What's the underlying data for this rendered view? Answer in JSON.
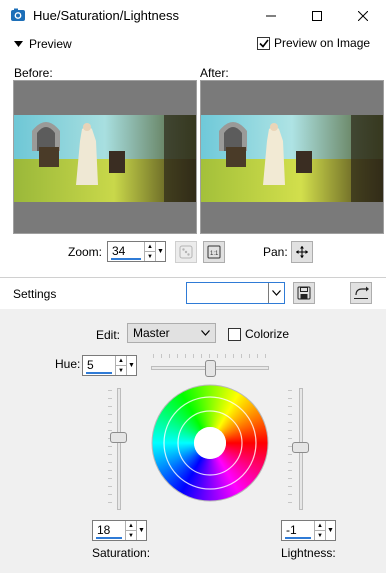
{
  "window": {
    "title": "Hue/Saturation/Lightness",
    "minimize_glyph": "—",
    "maximize_glyph": "☐",
    "close_glyph": "✕"
  },
  "preview": {
    "section_label": "Preview",
    "preview_on_image_label": "Preview on Image",
    "preview_on_image_checked": true,
    "before_label": "Before:",
    "after_label": "After:"
  },
  "zoom": {
    "label": "Zoom:",
    "value": "34",
    "pan_label": "Pan:"
  },
  "settings": {
    "label": "Settings",
    "preset_value": ""
  },
  "edit": {
    "label": "Edit:",
    "value": "Master",
    "colorize_label": "Colorize",
    "colorize_checked": false
  },
  "hue": {
    "label": "Hue:",
    "value": "5"
  },
  "saturation": {
    "label": "Saturation:",
    "value": "18"
  },
  "lightness": {
    "label": "Lightness:",
    "value": "-1"
  },
  "colors": {
    "accent": "#2f7bd6",
    "pane_bg": "#7a7a7a",
    "lower_bg": "#f0f0f0"
  }
}
